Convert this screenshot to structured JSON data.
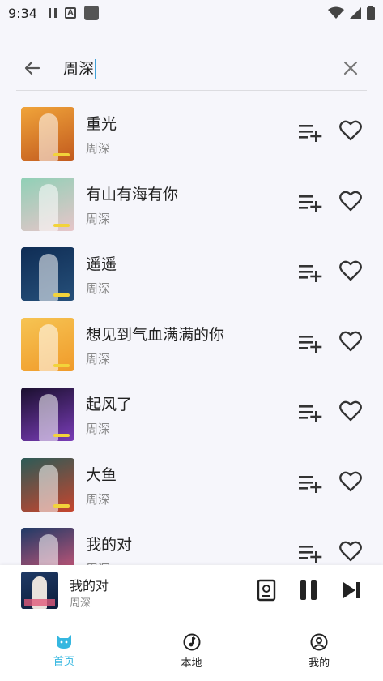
{
  "status_bar": {
    "time": "9:34",
    "icons": [
      "pause-icon",
      "a-icon",
      "square-icon",
      "wifi-icon",
      "signal-icon",
      "battery-icon"
    ]
  },
  "search": {
    "value": "周深",
    "back_icon": "arrow-left-icon",
    "clear_icon": "close-icon",
    "caret_color": "#3fa1d8"
  },
  "songs": [
    {
      "title": "重光",
      "artist": "周深",
      "cover_colors": [
        "#f0a43a",
        "#c25a1e"
      ]
    },
    {
      "title": "有山有海有你",
      "artist": "周深",
      "cover_colors": [
        "#8fd0b6",
        "#e7c5c9"
      ]
    },
    {
      "title": "遥遥",
      "artist": "周深",
      "cover_colors": [
        "#0f2d55",
        "#26507a"
      ]
    },
    {
      "title": "想见到气血满满的你",
      "artist": "周深",
      "cover_colors": [
        "#f6c453",
        "#f09a2a"
      ]
    },
    {
      "title": "起风了",
      "artist": "周深",
      "cover_colors": [
        "#1a0f2e",
        "#7a3db8"
      ]
    },
    {
      "title": "大鱼",
      "artist": "周深",
      "cover_colors": [
        "#2c5b57",
        "#c7452e"
      ]
    },
    {
      "title": "我的对",
      "artist": "周深",
      "cover_colors": [
        "#1f3a66",
        "#e05a7a"
      ]
    }
  ],
  "mini_player": {
    "title": "我的对",
    "artist": "周深"
  },
  "nav": {
    "items": [
      {
        "label": "首页",
        "icon": "cat-icon",
        "active": true
      },
      {
        "label": "本地",
        "icon": "music-note-icon",
        "active": false
      },
      {
        "label": "我的",
        "icon": "profile-icon",
        "active": false
      }
    ]
  },
  "colors": {
    "accent": "#35b7e0",
    "cover_accent_bar": "#f2d33a"
  }
}
